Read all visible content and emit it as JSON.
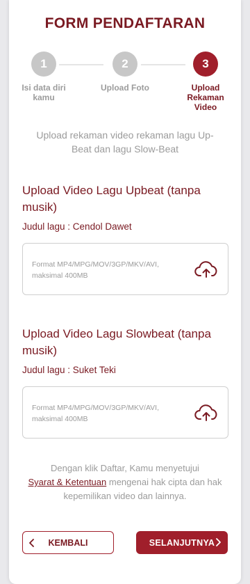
{
  "header": {
    "title": "FORM PENDAFTARAN"
  },
  "stepper": {
    "steps": [
      {
        "number": "1",
        "label": "Isi data diri kamu",
        "status": "done"
      },
      {
        "number": "2",
        "label": "Upload Foto",
        "status": "done"
      },
      {
        "number": "3",
        "label": "Upload Rekaman Video",
        "status": "active"
      }
    ]
  },
  "intro": "Upload rekaman video rekaman lagu Up-Beat dan lagu Slow-Beat",
  "upbeat": {
    "title": "Upload Video Lagu Upbeat (tanpa musik)",
    "song": "Judul lagu : Cendol Dawet",
    "format": "Format MP4/MPG/MOV/3GP/MKV/AVI, maksimal 400MB",
    "icon": "cloud-upload-icon"
  },
  "slowbeat": {
    "title": "Upload Video Lagu Slowbeat (tanpa musik)",
    "song": "Judul lagu : Suket Teki",
    "format": "Format MP4/MPG/MOV/3GP/MKV/AVI, maksimal 400MB",
    "icon": "cloud-upload-icon"
  },
  "consent": {
    "before": "Dengan klik Daftar, Kamu menyetujui",
    "link": "Syarat & Ketentuan",
    "after": "mengenai hak cipta dan hak kepemilikan video dan lainnya."
  },
  "buttons": {
    "back": "KEMBALI",
    "next": "SELANJUTNYA"
  },
  "colors": {
    "brand": "#7a1a22",
    "accent": "#a01f2b",
    "inactive": "#c7c7c7"
  }
}
